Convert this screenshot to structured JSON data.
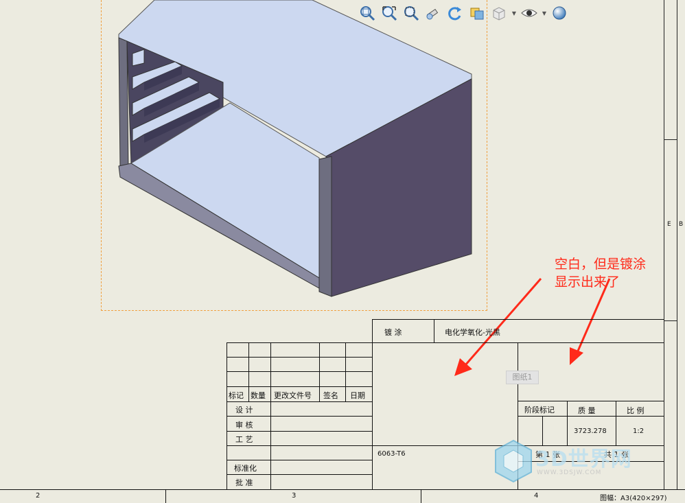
{
  "toolbar": {
    "buttons": [
      {
        "name": "zoom-to-fit-icon"
      },
      {
        "name": "zoom-to-area-icon"
      },
      {
        "name": "zoom-in-out-icon"
      },
      {
        "name": "pan-icon"
      },
      {
        "name": "rotate-icon"
      },
      {
        "name": "view-orientation-icon"
      },
      {
        "name": "display-style-icon"
      },
      {
        "name": "hide-show-items-icon"
      },
      {
        "name": "appearance-icon"
      }
    ]
  },
  "annotation": {
    "line1": "空白，但是镀涂",
    "line2": "显示出来了",
    "color": "#ff2a1a"
  },
  "title_block": {
    "coating_label": "镀    涂",
    "coating_value": "电化学氧化-光黑",
    "material": "6063-T6",
    "sheet_tag": "图纸1",
    "rev_headers": {
      "mark": "标记",
      "qty": "数量",
      "doc": "更改文件号",
      "sign": "签名",
      "date": "日期"
    },
    "roles": {
      "design": "设  计",
      "review": "审  核",
      "process": "工  艺",
      "standard": "标准化",
      "approve": "批  准"
    },
    "stage_label": "阶段标记",
    "mass_label": "质    量",
    "scale_label": "比  例",
    "mass_value": "3723.278",
    "scale_value": "1:2",
    "sheet_no": "第  1  张",
    "sheet_total": "共  1  张"
  },
  "ruler": {
    "n2": "2",
    "n3": "3",
    "n4": "4",
    "size_label": "图幅：A3(420×297)",
    "right_e": "E",
    "right_b": "B"
  },
  "watermark": {
    "text": "3D世界网",
    "url": "WWW.3DSJW.COM"
  }
}
